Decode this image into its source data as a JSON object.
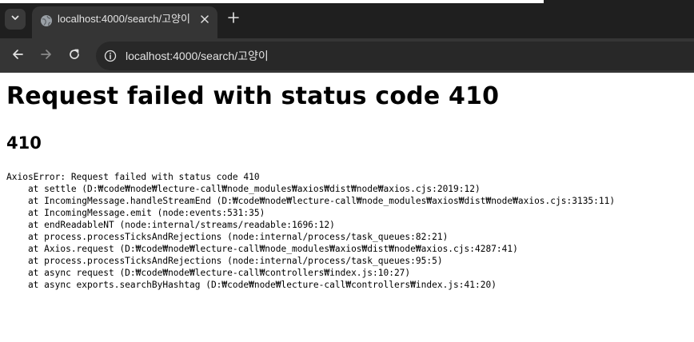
{
  "browser": {
    "tab": {
      "title": "localhost:4000/search/고양이"
    },
    "address_bar": {
      "url": "localhost:4000/search/고양이"
    },
    "colors": {
      "frame": "#1f1f1f",
      "toolbar": "#353535",
      "omnibox": "#282828",
      "text": "#e3e3e3"
    }
  },
  "page": {
    "heading": "Request failed with status code 410",
    "status_code": "410",
    "stack_trace": [
      "AxiosError: Request failed with status code 410",
      "    at settle (D:₩code₩node₩lecture-call₩node_modules₩axios₩dist₩node₩axios.cjs:2019:12)",
      "    at IncomingMessage.handleStreamEnd (D:₩code₩node₩lecture-call₩node_modules₩axios₩dist₩node₩axios.cjs:3135:11)",
      "    at IncomingMessage.emit (node:events:531:35)",
      "    at endReadableNT (node:internal/streams/readable:1696:12)",
      "    at process.processTicksAndRejections (node:internal/process/task_queues:82:21)",
      "    at Axios.request (D:₩code₩node₩lecture-call₩node_modules₩axios₩dist₩node₩axios.cjs:4287:41)",
      "    at process.processTicksAndRejections (node:internal/process/task_queues:95:5)",
      "    at async request (D:₩code₩node₩lecture-call₩controllers₩index.js:10:27)",
      "    at async exports.searchByHashtag (D:₩code₩node₩lecture-call₩controllers₩index.js:41:20)"
    ]
  }
}
